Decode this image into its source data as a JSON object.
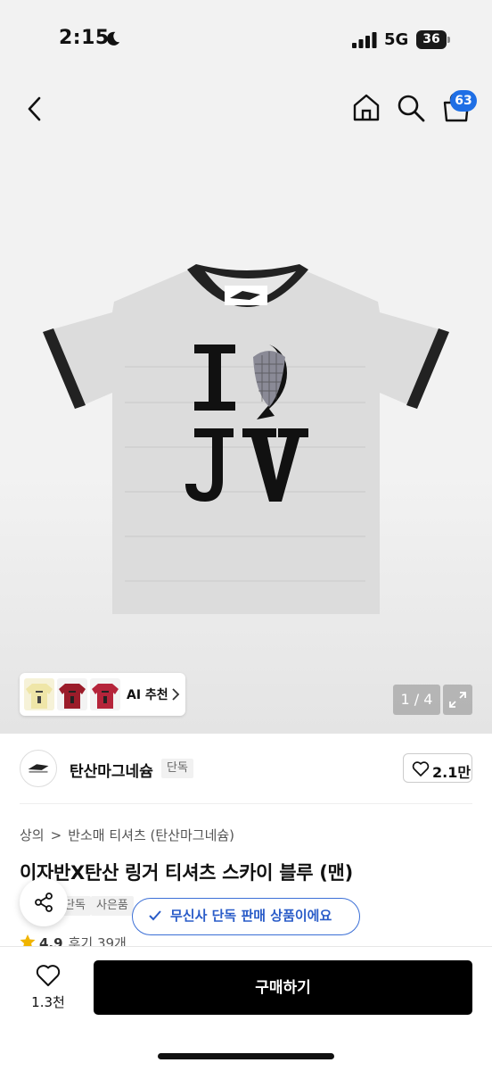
{
  "status_bar": {
    "time": "2:15",
    "network": "5G",
    "battery": "36"
  },
  "header": {
    "cart_count": "63"
  },
  "gallery": {
    "page_counter": "1 / 4",
    "ai_label": "AI 추천"
  },
  "brand": {
    "name": "탄산마그네슘",
    "badge": "단독",
    "likes": "2.1만"
  },
  "breadcrumb": {
    "items": [
      "상의",
      "반소매 티셔츠 (탄산마그네슘)"
    ]
  },
  "product": {
    "title": "이자반X탄산 링거 티셔츠 스카이 블루 (맨)",
    "tags": [
      "단독",
      "사은품"
    ],
    "exclusive_notice": "무신사 단독 판매 상품이에요",
    "rating": "4.9",
    "review_label": "후기 39개"
  },
  "bottom_bar": {
    "wish_count": "1.3천",
    "buy_label": "구매하기"
  },
  "colors": {
    "accent_blue": "#1f6fe5",
    "tooltip_blue": "#3b6fd6",
    "star": "#f0b400",
    "buy_button": "#000000"
  }
}
